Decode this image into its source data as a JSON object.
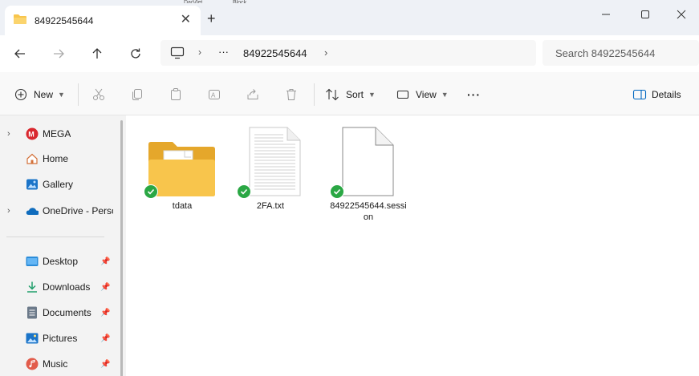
{
  "tab": {
    "title": "84922545644",
    "close_glyph": "✕"
  },
  "new_tab_glyph": "+",
  "peek": {
    "left": "DarVlet",
    "right": "Block"
  },
  "address": {
    "more_glyph": "···",
    "current": "84922545644"
  },
  "search": {
    "placeholder": "Search 84922545644"
  },
  "toolbar": {
    "new_label": "New",
    "sort_label": "Sort",
    "view_label": "View",
    "more_glyph": "···",
    "details_label": "Details"
  },
  "sidebar": {
    "items": [
      {
        "label": "MEGA",
        "expandable": true
      },
      {
        "label": "Home",
        "expandable": false
      },
      {
        "label": "Gallery",
        "expandable": false
      },
      {
        "label": "OneDrive - Personal",
        "expandable": true
      },
      {
        "label": "Desktop",
        "pinned": true
      },
      {
        "label": "Downloads",
        "pinned": true
      },
      {
        "label": "Documents",
        "pinned": true
      },
      {
        "label": "Pictures",
        "pinned": true
      },
      {
        "label": "Music",
        "pinned": true
      }
    ]
  },
  "files": [
    {
      "name": "tdata",
      "type": "folder"
    },
    {
      "name": "2FA.txt",
      "type": "text"
    },
    {
      "name": "84922545644.session",
      "type": "file"
    }
  ],
  "colors": {
    "accent": "#0067c0",
    "folder": "#f8c54c",
    "sync_ok": "#2aa744",
    "mega": "#d9272e"
  }
}
